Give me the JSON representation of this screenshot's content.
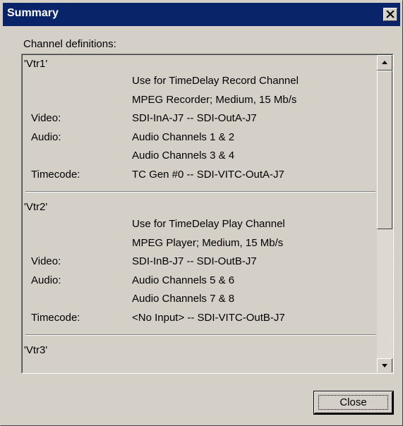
{
  "window": {
    "title": "Summary",
    "close_glyph": "✕"
  },
  "list_label": "Channel definitions:",
  "channels": [
    {
      "name": "'Vtr1'",
      "rows": [
        {
          "label": "",
          "value": "Use for TimeDelay Record Channel"
        },
        {
          "label": "",
          "value": "MPEG Recorder; Medium, 15 Mb/s"
        },
        {
          "label": "Video:",
          "value": "SDI-InA-J7 -- SDI-OutA-J7"
        },
        {
          "label": "Audio:",
          "value": "Audio Channels 1 & 2"
        },
        {
          "label": "",
          "value": "Audio Channels 3 & 4"
        },
        {
          "label": "Timecode:",
          "value": "TC Gen #0 -- SDI-VITC-OutA-J7"
        }
      ]
    },
    {
      "name": "'Vtr2'",
      "rows": [
        {
          "label": "",
          "value": "Use for TimeDelay Play Channel"
        },
        {
          "label": "",
          "value": "MPEG Player; Medium, 15 Mb/s"
        },
        {
          "label": "Video:",
          "value": "SDI-InB-J7 -- SDI-OutB-J7"
        },
        {
          "label": "Audio:",
          "value": "Audio Channels 5 & 6"
        },
        {
          "label": "",
          "value": "Audio Channels 7 & 8"
        },
        {
          "label": "Timecode:",
          "value": "<No Input> -- SDI-VITC-OutB-J7"
        }
      ]
    },
    {
      "name": "'Vtr3'",
      "rows": []
    }
  ],
  "buttons": {
    "close_label": "Close"
  },
  "colors": {
    "titlebar": "#0a246a",
    "face": "#d4d0c8"
  }
}
